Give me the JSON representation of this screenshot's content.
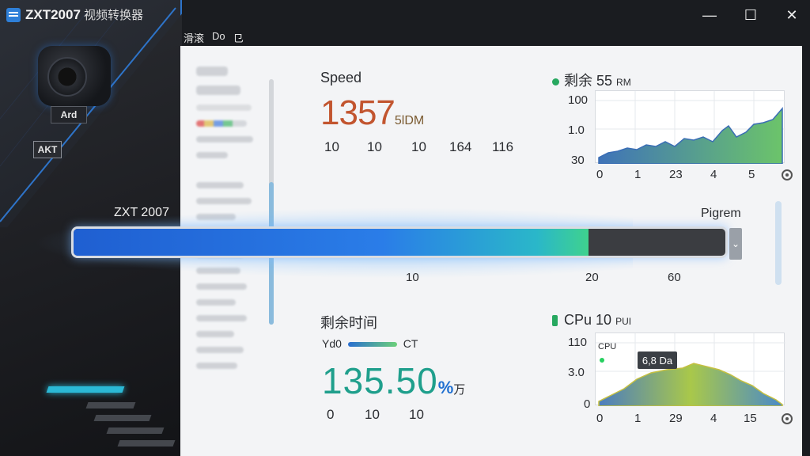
{
  "window": {
    "title": "ZXT2007",
    "title_sub": "视频转换器",
    "menu": [
      "滑滚",
      "Do",
      "㔾"
    ],
    "controls": {
      "minimize": "—",
      "maximize": "☐",
      "close": "✕"
    }
  },
  "device": {
    "label": "Ard",
    "badge": "AKT"
  },
  "speed": {
    "title": "Speed",
    "value": "1357",
    "unit": "5lDM",
    "numbers": [
      "10",
      "10",
      "10",
      "164",
      "116"
    ]
  },
  "remain_chart": {
    "legend": "剩余 55",
    "legend_unit": "RM",
    "y_ticks": [
      "100",
      "1.0",
      "30"
    ],
    "x_ticks": [
      "0",
      "1",
      "23",
      "4",
      "5"
    ]
  },
  "progress": {
    "left_label": "ZXT 2007",
    "right_label": "Pigrem",
    "percent": 79,
    "cap_icon": "⌄",
    "ticks": [
      "10",
      "20",
      "60"
    ]
  },
  "time": {
    "title": "剩余时间",
    "legend_left": "Yd0",
    "legend_right": "CT",
    "value": "135.50",
    "unit": "%",
    "unit_suffix": "万",
    "numbers": [
      "0",
      "10",
      "10"
    ]
  },
  "cpu_chart": {
    "legend": "CPu 10",
    "legend_unit": "PUI",
    "inner_label": "CPU",
    "tooltip": "6,8 Da",
    "y_ticks": [
      "110",
      "3.0",
      "0"
    ],
    "x_ticks": [
      "0",
      "1",
      "29",
      "4",
      "15"
    ]
  },
  "colors": {
    "accent": "#2e7fd8",
    "green": "#27a860",
    "orange": "#c2552f",
    "teal": "#1f9f8c"
  }
}
